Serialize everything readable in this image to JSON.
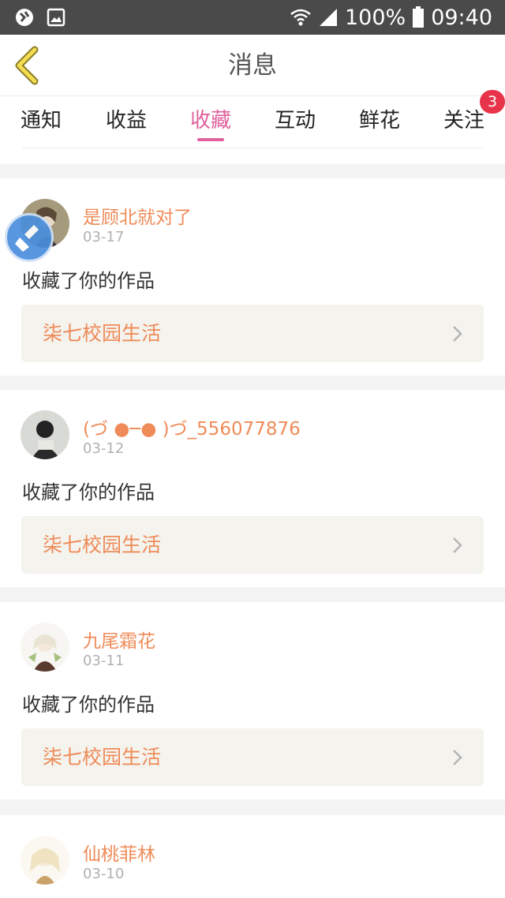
{
  "status_bar": {
    "battery": "100%",
    "time": "09:40",
    "icons": [
      "app-icon",
      "image-icon",
      "wifi-icon",
      "signal-icon",
      "battery-icon"
    ]
  },
  "header": {
    "title": "消息",
    "back_icon": "back-chevron-icon"
  },
  "tabs": [
    {
      "label": "通知"
    },
    {
      "label": "收益"
    },
    {
      "label": "收藏",
      "active": true
    },
    {
      "label": "互动"
    },
    {
      "label": "鲜花"
    },
    {
      "label": "关注",
      "badge": "3"
    }
  ],
  "notifications": [
    {
      "user": "是顾北就对了",
      "date": "03-17",
      "message": "收藏了你的作品",
      "work": "柒七校园生活"
    },
    {
      "user": "(づ ●─● )づ_556077876",
      "date": "03-12",
      "message": "收藏了你的作品",
      "work": "柒七校园生活"
    },
    {
      "user": "九尾霜花",
      "date": "03-11",
      "message": "收藏了你的作品",
      "work": "柒七校园生活"
    },
    {
      "user": "仙桃菲林",
      "date": "03-10"
    }
  ],
  "colors": {
    "accent_pink": "#e0619d",
    "username_orange": "#ef8b58",
    "badge_red": "#e8344a"
  }
}
